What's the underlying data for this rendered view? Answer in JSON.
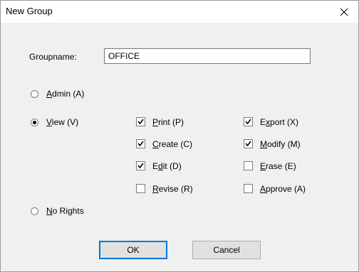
{
  "window": {
    "title": "New Group",
    "close_glyph": "X"
  },
  "groupname": {
    "label": "Groupname:",
    "value": "OFFICE"
  },
  "rights": {
    "admin": {
      "label_u": "A",
      "label_rest": "dmin (A)",
      "selected": false
    },
    "view": {
      "label_u": "V",
      "label_rest": "iew (V)",
      "selected": true
    },
    "none": {
      "label_u": "N",
      "label_rest": "o Rights",
      "selected": false
    }
  },
  "permissions": [
    {
      "pre": "",
      "u": "P",
      "post": "rint (P)",
      "checked": true
    },
    {
      "pre": "E",
      "u": "x",
      "post": "port (X)",
      "checked": true
    },
    {
      "pre": "",
      "u": "C",
      "post": "reate (C)",
      "checked": true
    },
    {
      "pre": "",
      "u": "M",
      "post": "odify (M)",
      "checked": true
    },
    {
      "pre": "E",
      "u": "d",
      "post": "it (D)",
      "checked": true
    },
    {
      "pre": "",
      "u": "E",
      "post": "rase (E)",
      "checked": false
    },
    {
      "pre": "",
      "u": "R",
      "post": "evise (R)",
      "checked": false
    },
    {
      "pre": "",
      "u": "A",
      "post": "pprove (A)",
      "checked": false
    }
  ],
  "buttons": {
    "ok": "OK",
    "cancel": "Cancel"
  }
}
